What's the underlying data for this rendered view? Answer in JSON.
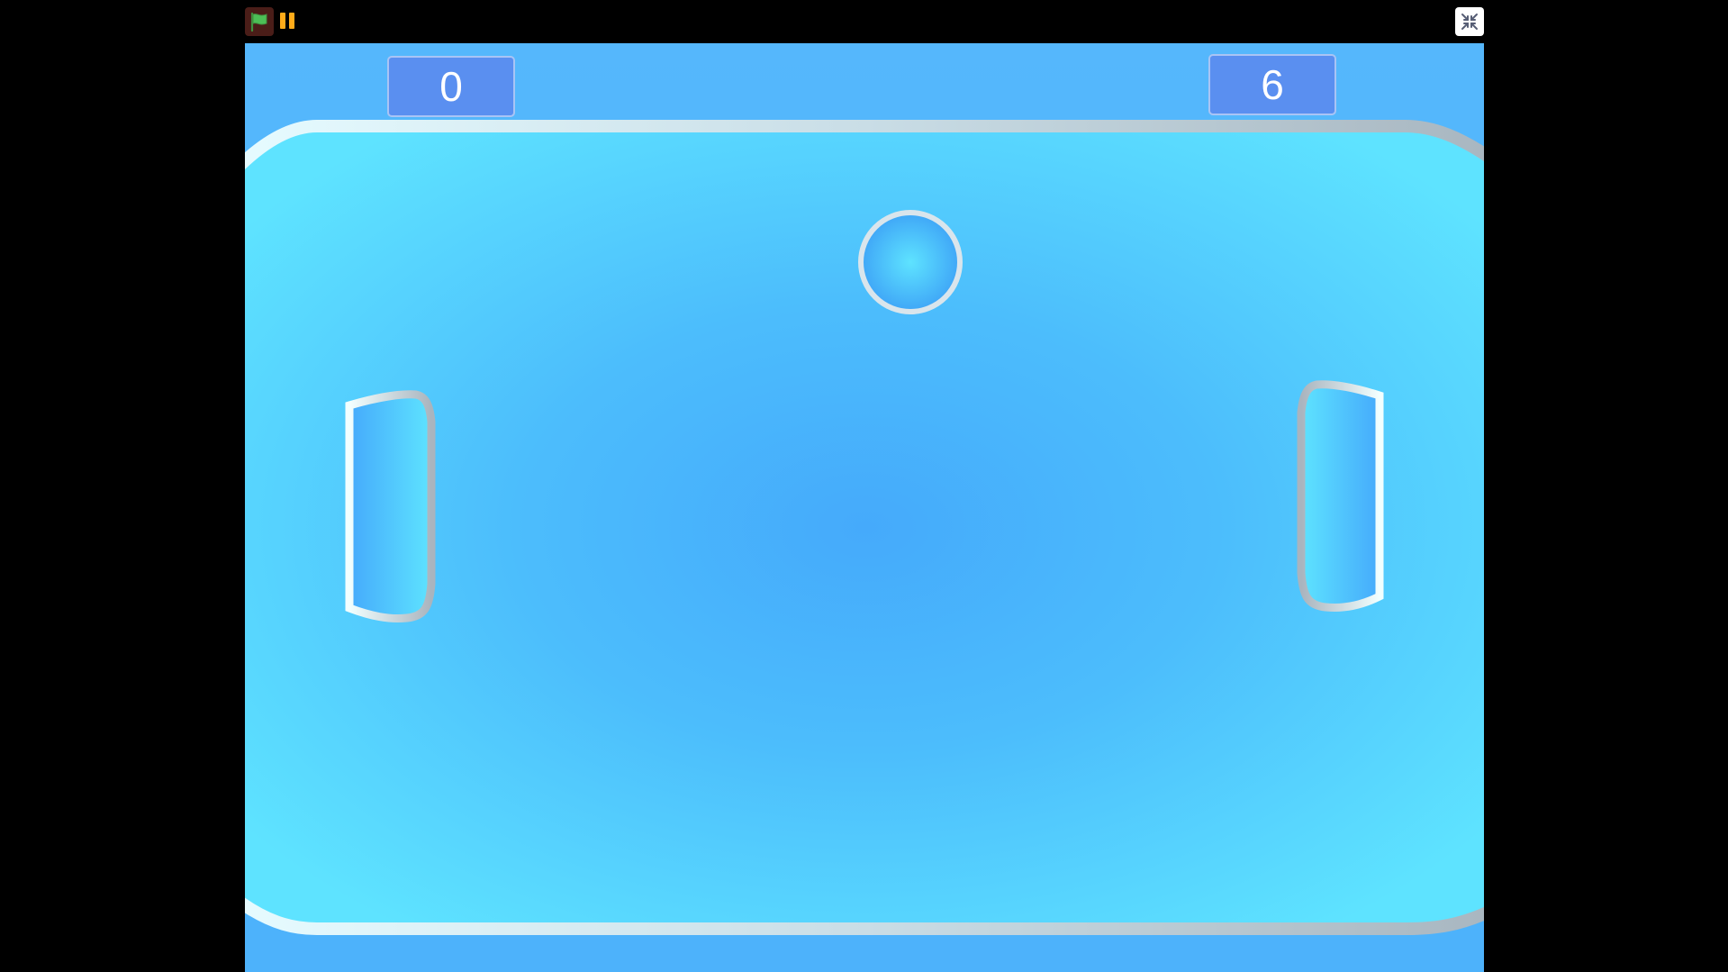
{
  "toolbar": {
    "green_flag_icon": "green-flag-icon",
    "pause_icon": "pause-icon",
    "exit_fullscreen_icon": "exit-fullscreen-icon"
  },
  "scores": {
    "left": "0",
    "right": "6"
  },
  "colors": {
    "background": "#000000",
    "stage_top": "#55b7fc",
    "field_edge": "#5ee3ff",
    "field_center": "#45aafb",
    "score_box": "#5a8ff0",
    "flag_button_bg": "#4a1d18",
    "flag_green": "#4cbf56",
    "pause_orange": "#ffab19"
  }
}
